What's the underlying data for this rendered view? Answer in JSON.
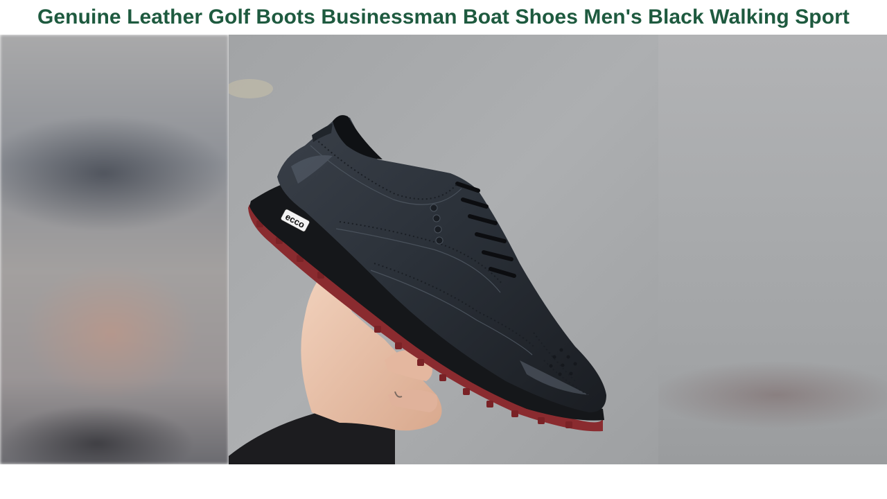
{
  "header": {
    "title": "Genuine Leather Golf Boots Businessman Boat Shoes Men's Black Walking Sport"
  },
  "photo": {
    "logo_text": "ecco"
  },
  "colors": {
    "title": "#1e5a3f",
    "leather": "#2b3139",
    "sole_red": "#8a2b2f",
    "background_asphalt": "#a7a9ab"
  }
}
